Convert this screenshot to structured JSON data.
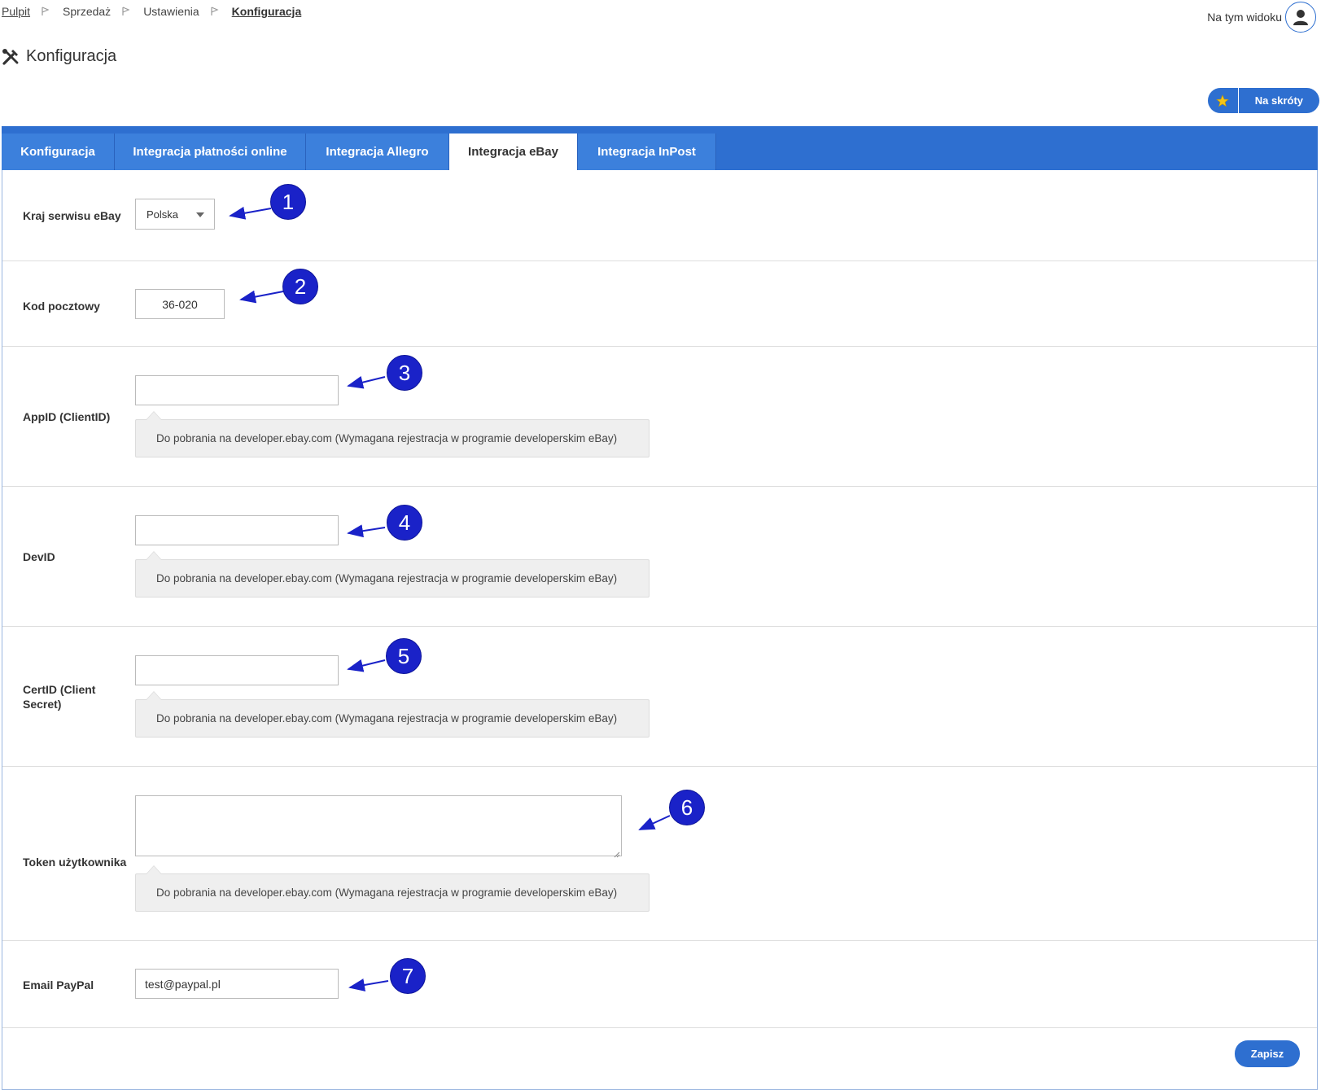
{
  "breadcrumb": {
    "items": [
      "Pulpit",
      "Sprzedaż",
      "Ustawienia",
      "Konfiguracja"
    ]
  },
  "header": {
    "view_label": "Na tym widoku",
    "title": "Konfiguracja",
    "shortcut_label": "Na skróty"
  },
  "tabs": [
    {
      "label": "Konfiguracja"
    },
    {
      "label": "Integracja płatności online"
    },
    {
      "label": "Integracja Allegro"
    },
    {
      "label": "Integracja eBay"
    },
    {
      "label": "Integracja InPost"
    }
  ],
  "form": {
    "country": {
      "label": "Kraj serwisu eBay",
      "value": "Polska"
    },
    "postal": {
      "label": "Kod pocztowy",
      "value": "36-020"
    },
    "appid": {
      "label": "AppID (ClientID)",
      "value": "",
      "hint": "Do pobrania na developer.ebay.com (Wymagana rejestracja w programie developerskim eBay)"
    },
    "devid": {
      "label": "DevID",
      "value": "",
      "hint": "Do pobrania na developer.ebay.com (Wymagana rejestracja w programie developerskim eBay)"
    },
    "certid": {
      "label_line1": "CertID (Client",
      "label_line2": "Secret)",
      "value": "",
      "hint": "Do pobrania na developer.ebay.com (Wymagana rejestracja w programie developerskim eBay)"
    },
    "token": {
      "label": "Token użytkownika",
      "value": "",
      "hint": "Do pobrania na developer.ebay.com (Wymagana rejestracja w programie developerskim eBay)"
    },
    "paypal": {
      "label": "Email PayPal",
      "value": "test@paypal.pl"
    }
  },
  "markers": [
    "1",
    "2",
    "3",
    "4",
    "5",
    "6",
    "7"
  ],
  "save_label": "Zapisz",
  "colors": {
    "accent": "#2e6fd0",
    "marker": "#1a22c8"
  }
}
